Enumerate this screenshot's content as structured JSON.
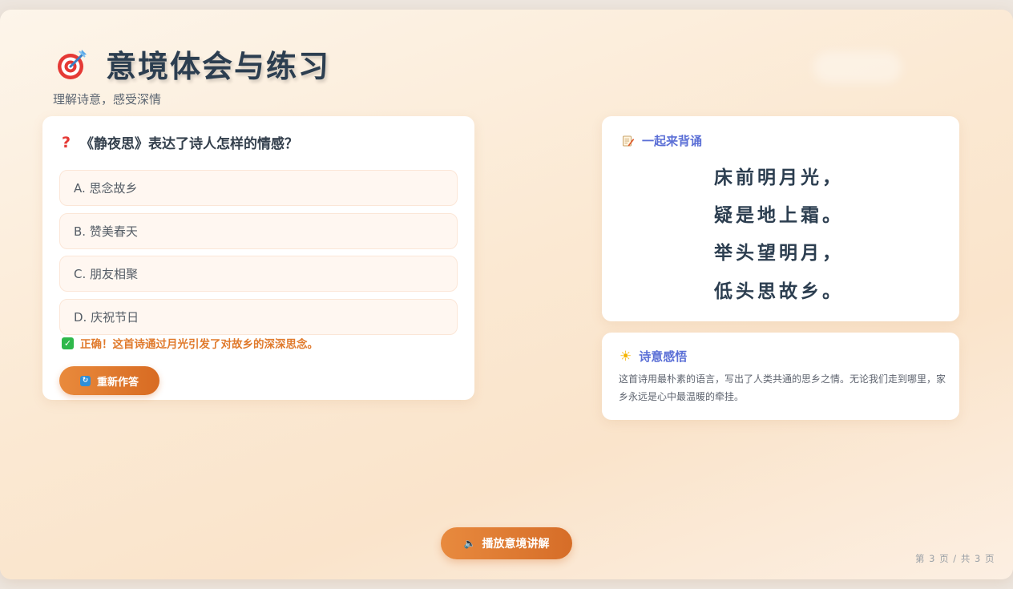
{
  "header": {
    "title": "意境体会与练习",
    "subtitle": "理解诗意，感受深情",
    "title_icon": "target-dart-icon"
  },
  "quiz": {
    "question_icon": "question-mark-icon",
    "question": "《静夜思》表达了诗人怎样的情感？",
    "options": [
      {
        "label": "A. 思念故乡"
      },
      {
        "label": "B. 赞美春天"
      },
      {
        "label": "C. 朋友相聚"
      },
      {
        "label": "D. 庆祝节日"
      }
    ],
    "feedback_icon": "check-box-icon",
    "feedback": "正确！这首诗通过月光引发了对故乡的深深思念。",
    "retry_icon": "refresh-icon",
    "retry_label": "重新作答"
  },
  "poem": {
    "heading_icon": "memo-icon",
    "heading": "一起来背诵",
    "lines": [
      "床前明月光，",
      "疑是地上霜。",
      "举头望明月，",
      "低头思故乡。"
    ]
  },
  "insight": {
    "heading_icon": "sun-icon",
    "heading": "诗意感悟",
    "text": "这首诗用最朴素的语言，写出了人类共通的思乡之情。无论我们走到哪里，家乡永远是心中最温暖的牵挂。"
  },
  "audio": {
    "icon": "speaker-icon",
    "label": "播放意境讲解"
  },
  "pagination": {
    "text": "第 3 页 / 共 3 页"
  },
  "colors": {
    "accent_orange": "#e07a2c",
    "heading_blue": "#5b6fd6",
    "correct_green": "#2eb84b",
    "title_dark": "#2c3e50"
  }
}
